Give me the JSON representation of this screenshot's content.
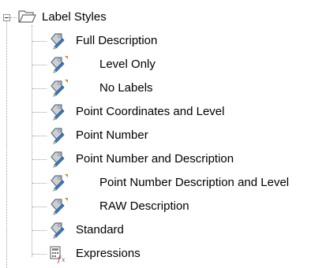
{
  "tree": {
    "root": {
      "label": "Label Styles",
      "icon": "folder-open-icon",
      "expanded": true
    },
    "items": [
      {
        "label": "Full Description",
        "icon": "label-style-icon",
        "child_style": false
      },
      {
        "label": "Level Only",
        "icon": "label-style-child-icon",
        "child_style": true
      },
      {
        "label": "No Labels",
        "icon": "label-style-child-icon",
        "child_style": true
      },
      {
        "label": "Point Coordinates and Level",
        "icon": "label-style-icon",
        "child_style": false
      },
      {
        "label": "Point Number",
        "icon": "label-style-icon",
        "child_style": false
      },
      {
        "label": "Point Number and Description",
        "icon": "label-style-icon",
        "child_style": false
      },
      {
        "label": "Point Number Description and Level",
        "icon": "label-style-child-icon",
        "child_style": true
      },
      {
        "label": "RAW Description",
        "icon": "label-style-child-icon",
        "child_style": true
      },
      {
        "label": "Standard",
        "icon": "label-style-icon",
        "child_style": false
      },
      {
        "label": "Expressions",
        "icon": "expressions-icon",
        "child_style": false
      }
    ]
  },
  "colors": {
    "connector": "#a0a0a0",
    "tag_fill": "#cfcfcf",
    "tag_stroke": "#5a6e86",
    "pencil_blue": "#3b7fc4",
    "child_marker": "#d08a1e",
    "expr_red": "#c83030",
    "expr_blue": "#2b66b8"
  }
}
